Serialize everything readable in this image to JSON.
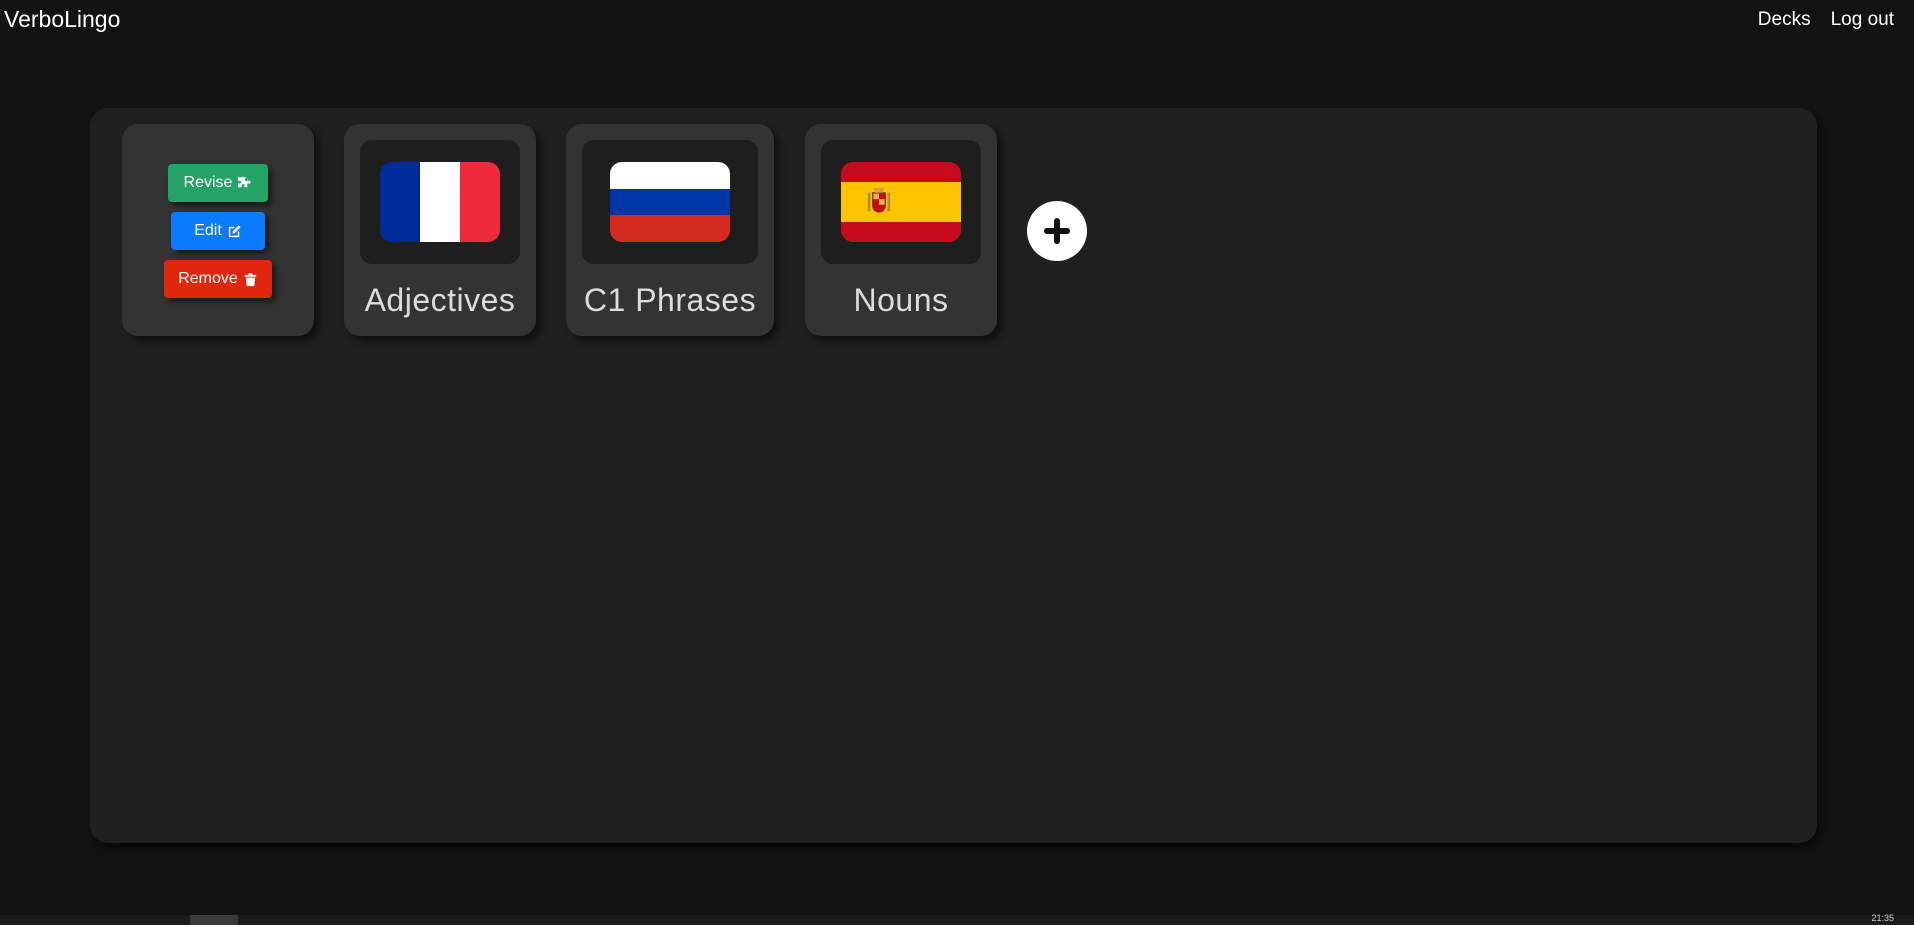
{
  "header": {
    "brand": "VerboLingo",
    "nav": [
      {
        "label": "Decks"
      },
      {
        "label": "Log out"
      }
    ]
  },
  "actions": {
    "revise_label": "Revise",
    "edit_label": "Edit",
    "remove_label": "Remove",
    "icons": [
      "puzzle-icon",
      "edit-icon",
      "trash-icon"
    ]
  },
  "decks": [
    {
      "title": "Adjectives",
      "flag": "france-flag",
      "colors": [
        "#002b9a",
        "#ffffff",
        "#ee2a3c"
      ]
    },
    {
      "title": "C1 Phrases",
      "flag": "russia-flag",
      "colors": [
        "#ffffff",
        "#0036a8",
        "#d52b1e"
      ]
    },
    {
      "title": "Nouns",
      "flag": "spain-flag",
      "colors": [
        "#c60b1e",
        "#ffc400",
        "#c60b1e"
      ]
    }
  ],
  "add_deck": {
    "icon": "plus-icon"
  },
  "taskbar": {
    "clock": "21:35"
  }
}
